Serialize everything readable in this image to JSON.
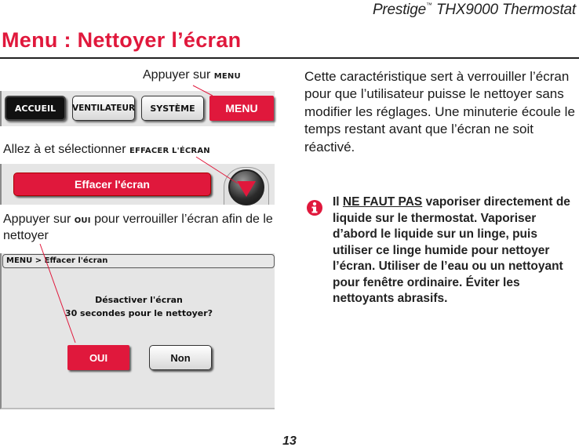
{
  "header": {
    "product": "Prestige",
    "trademark": "™",
    "model": "THX9000 Thermostat"
  },
  "page_title": "Menu : Nettoyer l’écran",
  "steps": [
    {
      "prefix": "Appuyer sur ",
      "key": "MENU",
      "suffix": ""
    },
    {
      "prefix": "Allez à et sélectionner ",
      "key": "EFFACER L'ÉCRAN",
      "suffix": ""
    },
    {
      "prefix": "Appuyer sur ",
      "key": "OUI",
      "suffix": " pour verrouiller l’écran afin de le nettoyer"
    }
  ],
  "screen_tabs": {
    "home": "ACCUEIL",
    "fan": "VENTILATEUR",
    "system": "SYSTÈME",
    "menu": "MENU"
  },
  "screen_menu": {
    "item": "Effacer l'écran",
    "scroll_down": "down-arrow"
  },
  "screen_dialog": {
    "breadcrumb": "MENU > Effacer l'écran",
    "line1": "Désactiver l'écran",
    "line2": "30 secondes pour le nettoyer?",
    "yes": "OUI",
    "no": "Non"
  },
  "intro_text": "Cette caractéristique sert à verrouiller l’écran pour que l’utilisateur puisse le nettoyer sans modifier les réglages. Une minuterie écoule le temps restant avant que l’écran ne soit réactivé.",
  "warning": {
    "icon": "info-icon",
    "lead": "Il ",
    "emphasis": "NE FAUT PAS",
    "text": " vaporiser directement de liquide sur le thermostat. Vaporiser d’abord le liquide sur un linge, puis utiliser ce linge humide pour nettoyer l’écran. Utiliser de l’eau ou un nettoyant pour fenêtre ordinaire. Éviter les nettoyants abrasifs."
  },
  "page_number": "13",
  "colors": {
    "accent": "#e0183c",
    "screen_bg": "#e5e5e5",
    "text": "#1a1a1a"
  }
}
